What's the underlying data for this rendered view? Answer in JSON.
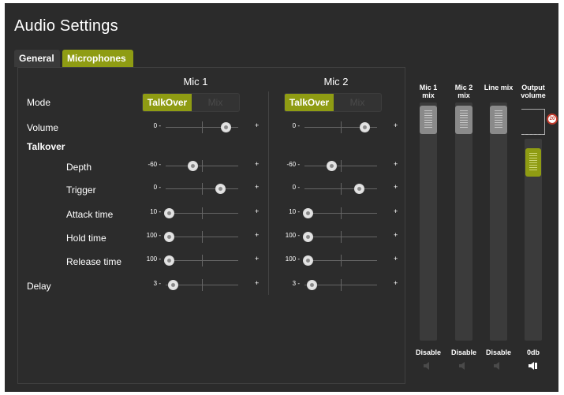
{
  "title": "Audio Settings",
  "tabs": [
    {
      "label": "General",
      "active": false
    },
    {
      "label": "Microphones",
      "active": true
    }
  ],
  "columns": [
    "Mic 1",
    "Mic 2"
  ],
  "rows": {
    "mode": "Mode",
    "volume": "Volume",
    "talkover_header": "Talkover",
    "depth": "Depth",
    "trigger": "Trigger",
    "attack": "Attack time",
    "hold": "Hold time",
    "release": "Release time",
    "delay": "Delay"
  },
  "mode_toggle": {
    "on": "TalkOver",
    "off": "Mix"
  },
  "mic1": {
    "volume": {
      "min": "0 -",
      "max": "+",
      "level": 0.95
    },
    "depth": {
      "min": "-60 -",
      "max": "+",
      "level": 0.4
    },
    "trigger": {
      "min": "0 -",
      "max": "+",
      "level": 0.85
    },
    "attack": {
      "min": "10 -",
      "max": "+",
      "level": 0.0
    },
    "hold": {
      "min": "100 -",
      "max": "+",
      "level": 0.0
    },
    "release": {
      "min": "100 -",
      "max": "+",
      "level": 0.0
    },
    "delay": {
      "min": "3 -",
      "max": "+",
      "level": 0.06
    }
  },
  "mic2": {
    "volume": {
      "min": "0 -",
      "max": "+",
      "level": 0.95
    },
    "depth": {
      "min": "-60 -",
      "max": "+",
      "level": 0.4
    },
    "trigger": {
      "min": "0 -",
      "max": "+",
      "level": 0.85
    },
    "attack": {
      "min": "10 -",
      "max": "+",
      "level": 0.0
    },
    "hold": {
      "min": "100 -",
      "max": "+",
      "level": 0.0
    },
    "release": {
      "min": "100 -",
      "max": "+",
      "level": 0.0
    },
    "delay": {
      "min": "3 -",
      "max": "+",
      "level": 0.06
    }
  },
  "mixer": {
    "mic1": {
      "label": "Mic 1 mix",
      "state": "Disable"
    },
    "mic2": {
      "label": "Mic 2 mix",
      "state": "Disable"
    },
    "line": {
      "label": "Line mix",
      "state": "Disable"
    },
    "output": {
      "label": "Output volume",
      "state": "0db",
      "badge": "20"
    }
  },
  "colors": {
    "accent": "#8f9c13",
    "panel": "#2b2b2b",
    "alert": "#c0392b"
  },
  "icons": {
    "speaker": "speaker-icon",
    "badge": "peak-badge-icon"
  }
}
